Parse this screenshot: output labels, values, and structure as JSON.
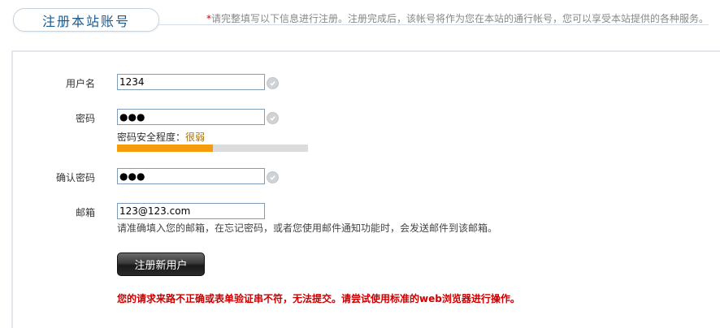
{
  "header": {
    "title": "注册本站账号",
    "notice_star": "*",
    "notice": "请完整填写以下信息进行注册。注册完成后，该帐号将作为您在本站的通行帐号，您可以享受本站提供的各种服务。"
  },
  "form": {
    "username": {
      "label": "用户名",
      "value": "1234"
    },
    "password": {
      "label": "密码",
      "value": "●●●"
    },
    "strength": {
      "label": "密码安全程度：",
      "level": "很弱",
      "percent": 50
    },
    "confirm": {
      "label": "确认密码",
      "value": "●●●"
    },
    "email": {
      "label": "邮箱",
      "value": "123@123.com",
      "hint": "请准确填入您的邮箱，在忘记密码，或者您使用邮件通知功能时，会发送邮件到该邮箱。"
    },
    "submit_label": "注册新用户",
    "error": "您的请求来路不正确或表单验证串不符，无法提交。请尝试使用标准的web浏览器进行操作。"
  },
  "colors": {
    "title": "#1c5a8e",
    "strength_fill": "#f49b0e",
    "error": "#cc0000"
  },
  "icons": {
    "valid": "check-circle-icon"
  }
}
